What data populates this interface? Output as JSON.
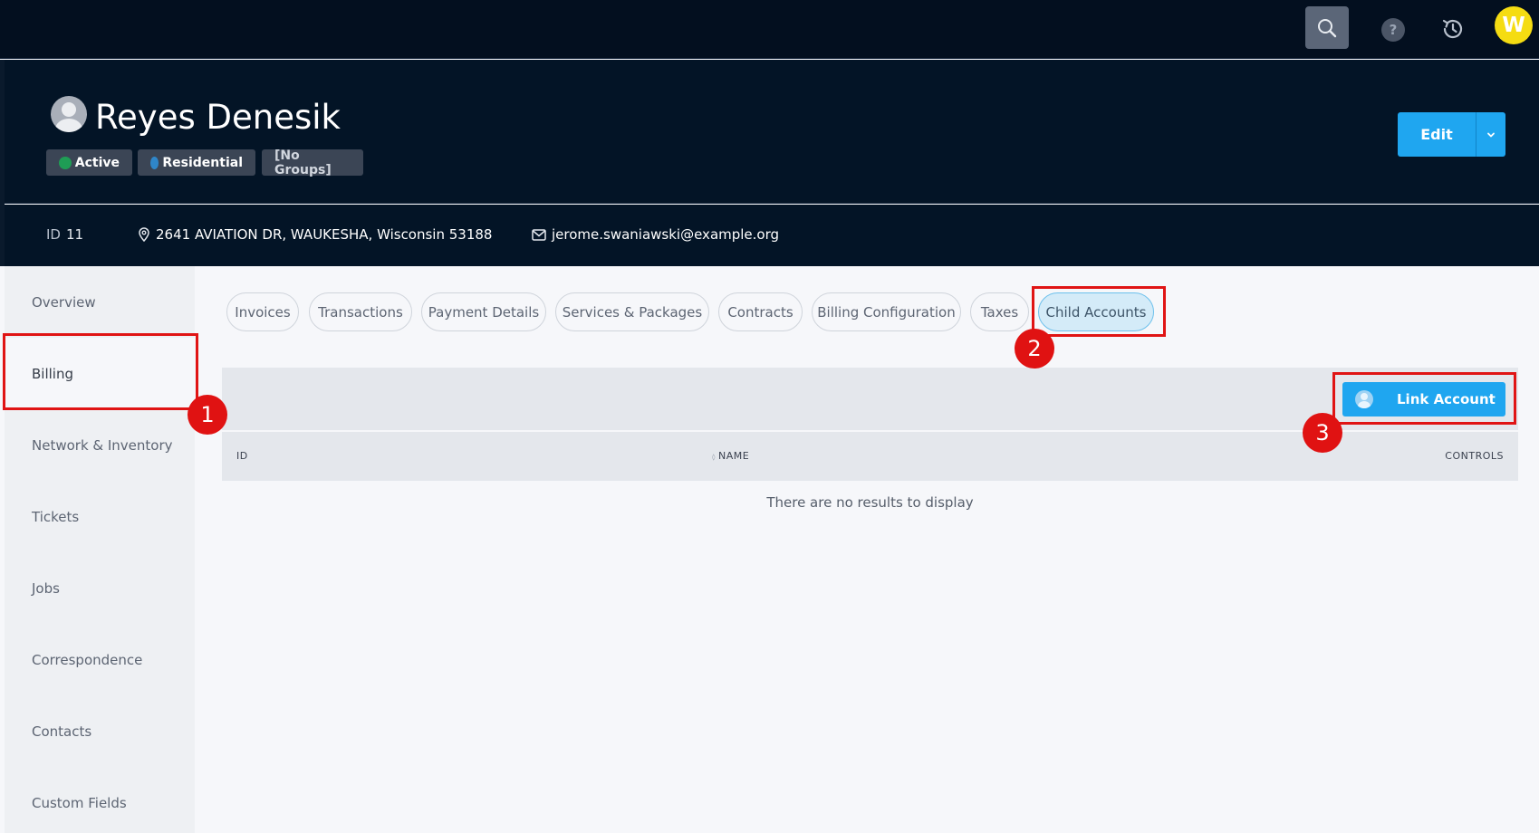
{
  "topbar": {
    "search_icon": "search-icon",
    "help_glyph": "?",
    "history_icon": "history-icon",
    "user_initial": "W"
  },
  "customer": {
    "name": "Reyes Denesik",
    "badges": {
      "status": "Active",
      "status_color": "#1f9d55",
      "category": "Residential",
      "category_color": "#2f86c9",
      "groups": "[No Groups]"
    },
    "edit_label": "Edit",
    "id_label": "ID",
    "id_value": "11",
    "address": "2641 AVIATION DR, WAUKESHA, Wisconsin 53188",
    "email": "jerome.swaniawski@example.org"
  },
  "sidebar": {
    "items": [
      {
        "label": "Overview"
      },
      {
        "label": "Billing"
      },
      {
        "label": "Network & Inventory"
      },
      {
        "label": "Tickets"
      },
      {
        "label": "Jobs"
      },
      {
        "label": "Correspondence"
      },
      {
        "label": "Contacts"
      },
      {
        "label": "Custom Fields"
      }
    ],
    "active": "Billing"
  },
  "tabs": {
    "items": [
      {
        "label": "Invoices"
      },
      {
        "label": "Transactions"
      },
      {
        "label": "Payment Details"
      },
      {
        "label": "Services & Packages"
      },
      {
        "label": "Contracts"
      },
      {
        "label": "Billing Configuration"
      },
      {
        "label": "Taxes"
      },
      {
        "label": "Child Accounts"
      }
    ],
    "active": "Child Accounts"
  },
  "table": {
    "link_account_label": "Link Account",
    "columns": [
      "ID",
      "NAME",
      "CONTROLS"
    ],
    "rows": [],
    "empty_message": "There are no results to display"
  },
  "annotations": {
    "steps": [
      "1",
      "2",
      "3"
    ],
    "color": "#e01414"
  },
  "colors": {
    "accent": "#1fa6f0",
    "header_bg": "#031426",
    "topbar_bg": "#030f1f"
  }
}
